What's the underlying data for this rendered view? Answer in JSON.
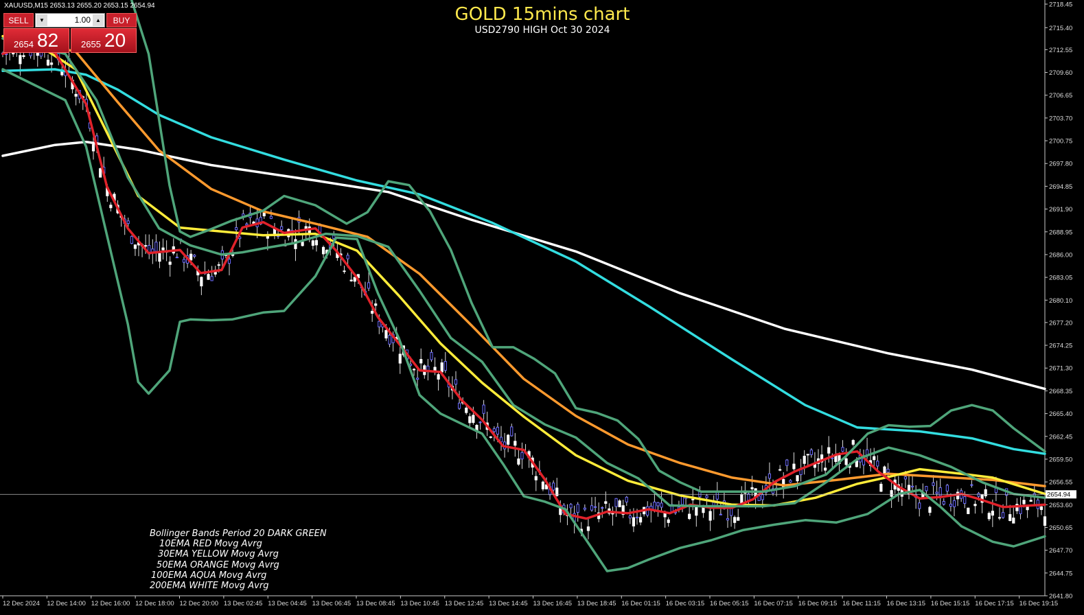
{
  "symbol_header": "XAUUSD,M15  2653.13 2655.20 2653.15 2654.94",
  "trade_panel": {
    "sell_label": "SELL",
    "buy_label": "BUY",
    "lot": "1.00",
    "sell_price_small": "2654",
    "sell_price_big": "82",
    "buy_price_small": "2655",
    "buy_price_big": "20"
  },
  "chart_data": {
    "type": "line",
    "title": "GOLD 15mins chart",
    "subtitle": "USD2790  HIGH Oct 30 2024",
    "xlabel": "",
    "ylabel": "",
    "ylim": [
      2641.8,
      2718.45
    ],
    "y_ticks": [
      "2718.45",
      "2715.40",
      "2712.55",
      "2709.60",
      "2706.65",
      "2703.70",
      "2700.75",
      "2697.80",
      "2694.85",
      "2691.90",
      "2688.95",
      "2686.00",
      "2683.05",
      "2680.10",
      "2677.20",
      "2674.25",
      "2671.30",
      "2668.35",
      "2665.40",
      "2662.45",
      "2659.50",
      "2656.55",
      "2653.60",
      "2650.65",
      "2647.70",
      "2644.75",
      "2641.80"
    ],
    "current_price": "2654.94",
    "x_ticks": [
      "12 Dec 2024",
      "12 Dec 14:00",
      "12 Dec 16:00",
      "12 Dec 18:00",
      "12 Dec 20:00",
      "13 Dec 02:45",
      "13 Dec 04:45",
      "13 Dec 06:45",
      "13 Dec 08:45",
      "13 Dec 10:45",
      "13 Dec 12:45",
      "13 Dec 14:45",
      "13 Dec 16:45",
      "13 Dec 18:45",
      "16 Dec 01:15",
      "16 Dec 03:15",
      "16 Dec 05:15",
      "16 Dec 07:15",
      "16 Dec 09:15",
      "16 Dec 11:15",
      "16 Dec 13:15",
      "16 Dec 15:15",
      "16 Dec 17:15",
      "16 Dec 19:15"
    ],
    "x_range": [
      0,
      1
    ],
    "series": [
      {
        "name": "200EMA WHITE",
        "color": "#ffffff",
        "x": [
          0,
          0.05,
          0.08,
          0.13,
          0.2,
          0.3,
          0.37,
          0.45,
          0.55,
          0.65,
          0.75,
          0.85,
          0.93,
          1
        ],
        "y": [
          2698.8,
          2700.2,
          2700.6,
          2699.6,
          2697.6,
          2695.6,
          2694.1,
          2690.5,
          2686.4,
          2681.0,
          2676.4,
          2673.2,
          2671.1,
          2668.6
        ]
      },
      {
        "name": "100EMA AQUA",
        "color": "#33dde0",
        "x": [
          0,
          0.05,
          0.08,
          0.11,
          0.15,
          0.2,
          0.27,
          0.34,
          0.4,
          0.47,
          0.55,
          0.62,
          0.7,
          0.77,
          0.82,
          0.88,
          0.93,
          0.97,
          1
        ],
        "y": [
          2709.8,
          2710.0,
          2709.3,
          2707.4,
          2704.1,
          2701.2,
          2698.3,
          2695.6,
          2693.8,
          2690.1,
          2685.1,
          2679.3,
          2672.4,
          2666.5,
          2663.6,
          2663.1,
          2662.2,
          2660.8,
          2660.2
        ]
      },
      {
        "name": "50EMA ORANGE",
        "color": "#ff9a2e",
        "x": [
          0,
          0.03,
          0.07,
          0.11,
          0.15,
          0.2,
          0.25,
          0.3,
          0.35,
          0.4,
          0.45,
          0.5,
          0.55,
          0.6,
          0.65,
          0.7,
          0.75,
          0.8,
          0.85,
          0.9,
          0.95,
          1
        ],
        "y": [
          2714.0,
          2713.5,
          2712.3,
          2705.8,
          2699.5,
          2694.5,
          2691.6,
          2690.0,
          2688.3,
          2683.5,
          2676.8,
          2669.9,
          2665.1,
          2661.4,
          2659.0,
          2657.1,
          2656.1,
          2656.8,
          2657.6,
          2657.2,
          2656.8,
          2656.0
        ]
      },
      {
        "name": "30EMA YELLOW",
        "color": "#ffec3a",
        "x": [
          0,
          0.03,
          0.07,
          0.1,
          0.13,
          0.17,
          0.21,
          0.25,
          0.3,
          0.34,
          0.38,
          0.42,
          0.46,
          0.5,
          0.55,
          0.6,
          0.65,
          0.7,
          0.74,
          0.78,
          0.82,
          0.85,
          0.88,
          0.92,
          0.95,
          1
        ],
        "y": [
          2714.3,
          2713.5,
          2710.0,
          2701.8,
          2693.6,
          2689.5,
          2689.0,
          2688.5,
          2688.7,
          2686.5,
          2680.7,
          2674.5,
          2669.4,
          2665.0,
          2660.0,
          2656.7,
          2654.8,
          2653.6,
          2653.5,
          2654.5,
          2656.3,
          2657.2,
          2658.2,
          2657.6,
          2657.1,
          2655.0
        ]
      },
      {
        "name": "10EMA RED",
        "color": "#e0222a",
        "x": [
          0,
          0.02,
          0.05,
          0.08,
          0.1,
          0.12,
          0.14,
          0.17,
          0.19,
          0.21,
          0.23,
          0.25,
          0.27,
          0.3,
          0.32,
          0.34,
          0.36,
          0.38,
          0.4,
          0.42,
          0.44,
          0.46,
          0.48,
          0.5,
          0.52,
          0.54,
          0.56,
          0.58,
          0.6,
          0.62,
          0.64,
          0.66,
          0.68,
          0.7,
          0.72,
          0.74,
          0.76,
          0.78,
          0.8,
          0.82,
          0.84,
          0.86,
          0.88,
          0.9,
          0.92,
          0.94,
          0.96,
          1
        ],
        "y": [
          2712.0,
          2713.0,
          2712.2,
          2705.5,
          2694.8,
          2689.4,
          2686.2,
          2686.6,
          2683.6,
          2684.0,
          2689.5,
          2690.2,
          2688.8,
          2689.4,
          2686.5,
          2683.0,
          2677.9,
          2674.5,
          2671.0,
          2670.8,
          2667.2,
          2664.6,
          2661.2,
          2660.7,
          2656.9,
          2652.4,
          2651.8,
          2652.7,
          2652.5,
          2653.0,
          2652.5,
          2653.6,
          2653.2,
          2653.2,
          2654.3,
          2656.5,
          2657.9,
          2659.0,
          2660.1,
          2660.5,
          2657.9,
          2655.9,
          2654.4,
          2654.6,
          2655.0,
          2654.2,
          2653.3,
          2653.6
        ]
      },
      {
        "name": "BB UPPER",
        "color": "#4fa57a",
        "x": [
          0,
          0.04,
          0.08,
          0.1,
          0.12,
          0.14,
          0.15,
          0.16,
          0.17,
          0.18,
          0.2,
          0.22,
          0.25,
          0.27,
          0.3,
          0.33,
          0.35,
          0.37,
          0.39,
          0.41,
          0.43,
          0.45,
          0.47,
          0.49,
          0.51,
          0.53,
          0.55,
          0.57,
          0.59,
          0.61,
          0.63,
          0.65,
          0.67,
          0.7,
          0.73,
          0.76,
          0.79,
          0.81,
          0.83,
          0.85,
          0.87,
          0.89,
          0.91,
          0.93,
          0.95,
          0.97,
          1
        ],
        "y": [
          2720.0,
          2722.0,
          2722.0,
          2721.0,
          2720.5,
          2712.0,
          2703.5,
          2695.0,
          2689.0,
          2688.3,
          2689.3,
          2690.4,
          2691.7,
          2693.6,
          2692.4,
          2690.0,
          2691.5,
          2695.5,
          2695.0,
          2691.6,
          2686.6,
          2679.7,
          2674.0,
          2674.0,
          2672.5,
          2670.6,
          2666.1,
          2665.5,
          2664.5,
          2662.1,
          2658.0,
          2656.5,
          2655.3,
          2655.3,
          2655.3,
          2656.0,
          2657.5,
          2660.0,
          2662.8,
          2663.9,
          2663.7,
          2663.8,
          2665.8,
          2666.5,
          2665.8,
          2663.5,
          2660.5
        ]
      },
      {
        "name": "BB MIDDLE",
        "color": "#4fa57a",
        "x": [
          0,
          0.03,
          0.06,
          0.09,
          0.12,
          0.15,
          0.18,
          0.21,
          0.23,
          0.25,
          0.28,
          0.31,
          0.34,
          0.37,
          0.4,
          0.43,
          0.46,
          0.49,
          0.52,
          0.55,
          0.58,
          0.61,
          0.64,
          0.67,
          0.7,
          0.73,
          0.76,
          0.79,
          0.82,
          0.85,
          0.88,
          0.91,
          0.94,
          0.97,
          1
        ],
        "y": [
          2714.0,
          2713.0,
          2712.0,
          2706.0,
          2696.0,
          2689.4,
          2687.2,
          2686.0,
          2686.3,
          2686.8,
          2687.5,
          2688.7,
          2688.4,
          2687.0,
          2681.3,
          2675.2,
          2672.1,
          2666.5,
          2664.0,
          2662.3,
          2659.0,
          2657.0,
          2653.5,
          2653.4,
          2653.4,
          2653.4,
          2653.8,
          2656.5,
          2659.5,
          2661.0,
          2660.0,
          2658.5,
          2656.5,
          2655.0,
          2654.5
        ]
      },
      {
        "name": "BB LOWER",
        "color": "#4fa57a",
        "x": [
          0,
          0.03,
          0.06,
          0.08,
          0.1,
          0.12,
          0.13,
          0.14,
          0.16,
          0.17,
          0.18,
          0.2,
          0.22,
          0.25,
          0.27,
          0.3,
          0.32,
          0.34,
          0.36,
          0.38,
          0.4,
          0.42,
          0.44,
          0.46,
          0.48,
          0.5,
          0.52,
          0.54,
          0.56,
          0.58,
          0.6,
          0.62,
          0.65,
          0.68,
          0.71,
          0.74,
          0.77,
          0.8,
          0.83,
          0.86,
          0.88,
          0.9,
          0.92,
          0.95,
          0.97,
          1
        ],
        "y": [
          2710.0,
          2708.0,
          2706.0,
          2700.0,
          2688.5,
          2677.0,
          2669.5,
          2668.0,
          2671.0,
          2677.3,
          2677.6,
          2677.5,
          2677.6,
          2678.5,
          2678.7,
          2683.2,
          2688.2,
          2688.0,
          2681.0,
          2675.2,
          2667.8,
          2665.4,
          2664.1,
          2662.8,
          2658.9,
          2654.7,
          2654.0,
          2653.0,
          2649.0,
          2645.0,
          2645.4,
          2646.5,
          2648.0,
          2649.0,
          2650.3,
          2651.0,
          2651.6,
          2651.3,
          2652.4,
          2655.0,
          2655.5,
          2653.3,
          2650.8,
          2648.8,
          2648.2,
          2649.5
        ]
      }
    ]
  }
}
